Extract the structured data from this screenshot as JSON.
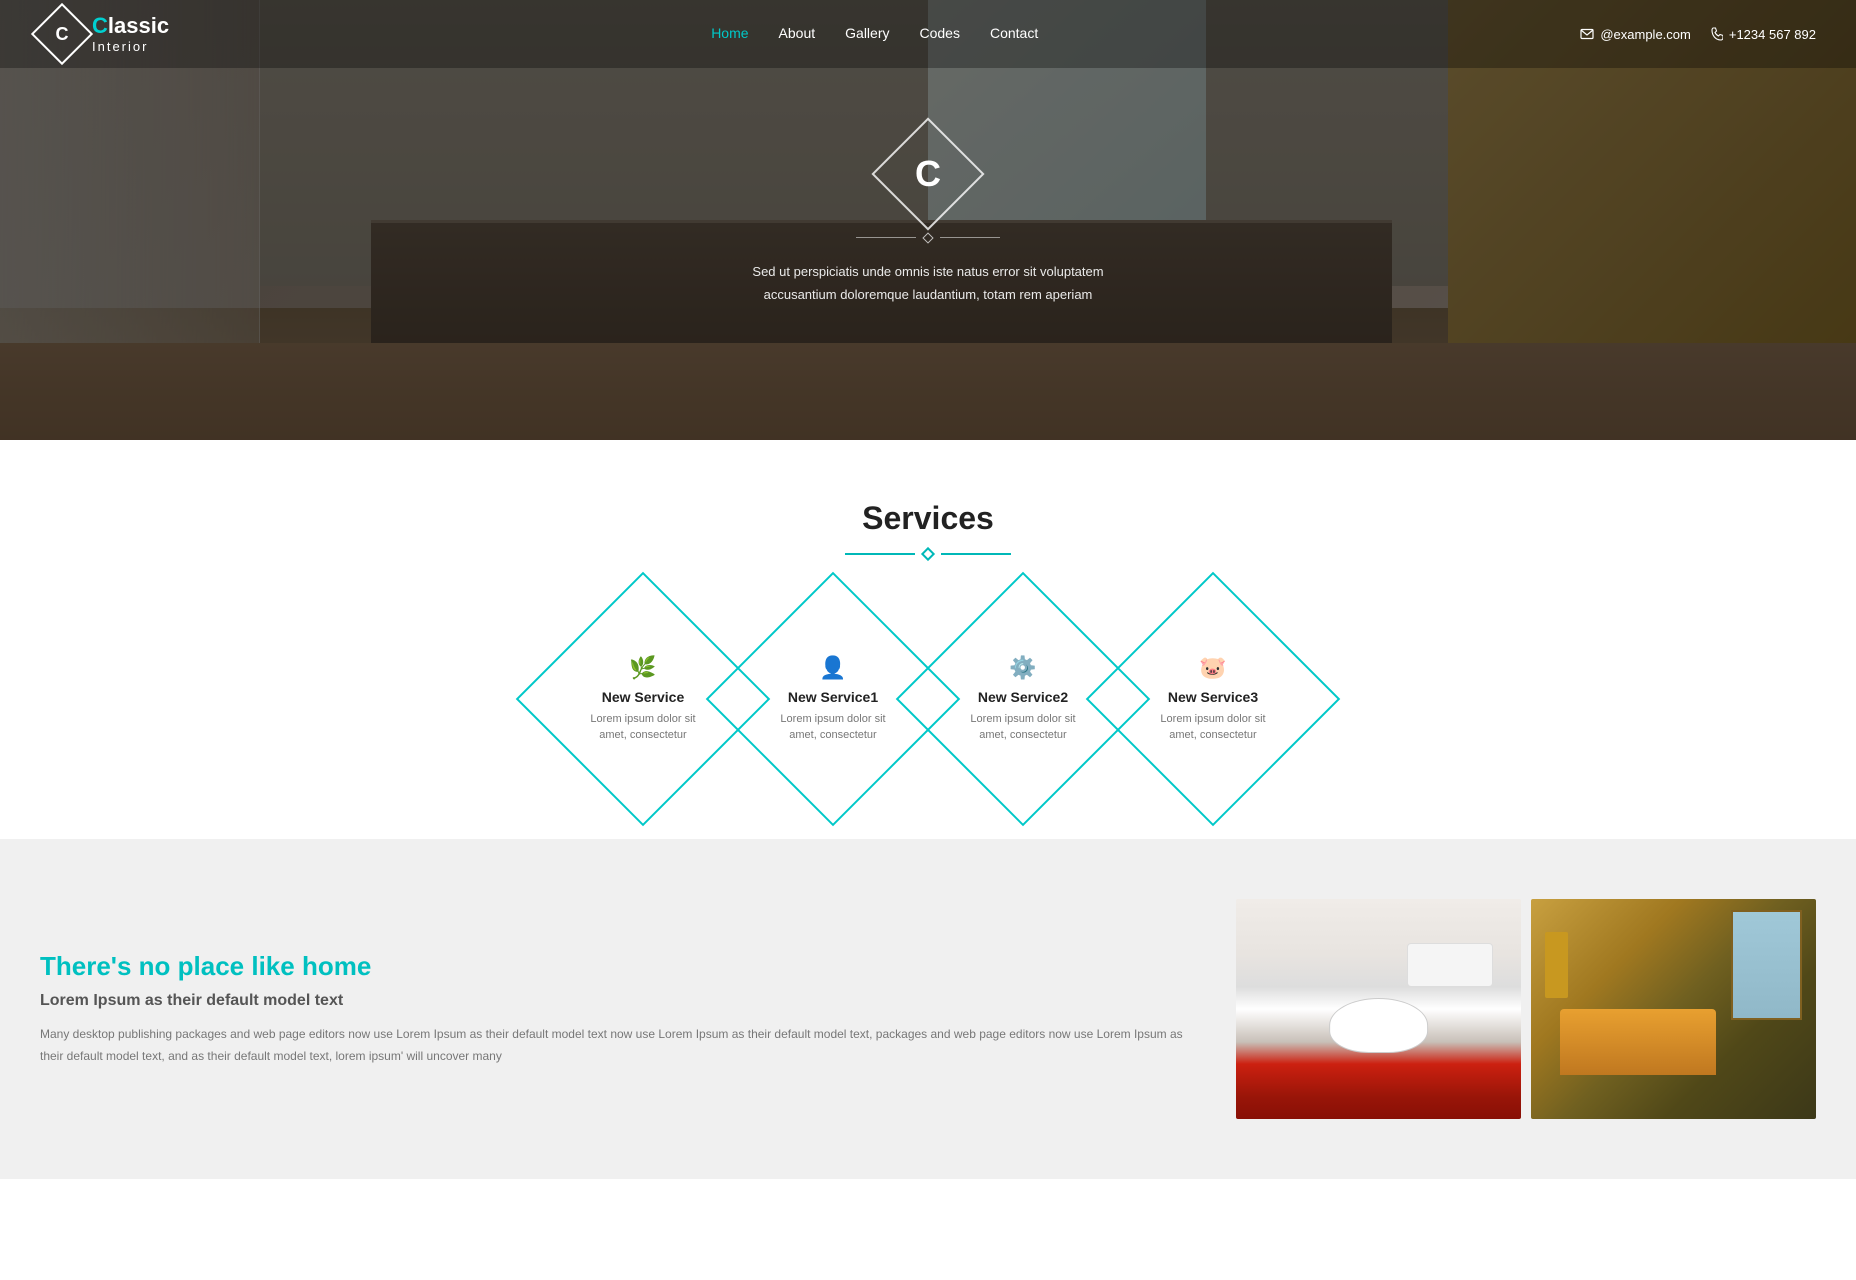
{
  "navbar": {
    "logo": {
      "letter": "C",
      "brand": "lassic",
      "sub": "Interior"
    },
    "nav_items": [
      {
        "label": "Home",
        "active": true
      },
      {
        "label": "About",
        "active": false
      },
      {
        "label": "Gallery",
        "active": false
      },
      {
        "label": "Codes",
        "active": false
      },
      {
        "label": "Contact",
        "active": false
      }
    ],
    "contact_email": "@example.com",
    "contact_phone": "+1234 567 892"
  },
  "hero": {
    "letter": "C",
    "tagline": "Sed ut perspiciatis unde omnis iste natus error sit voluptatem accusantium doloremque laudantium, totam rem aperiam"
  },
  "services": {
    "title": "Services",
    "items": [
      {
        "icon": "🌿",
        "name": "New Service",
        "desc": "Lorem ipsum dolor sit amet, consectetur"
      },
      {
        "icon": "👤",
        "name": "New Service1",
        "desc": "Lorem ipsum dolor sit amet, consectetur"
      },
      {
        "icon": "⚙️",
        "name": "New Service2",
        "desc": "Lorem ipsum dolor sit amet, consectetur"
      },
      {
        "icon": "🐷",
        "name": "New Service3",
        "desc": "Lorem ipsum dolor sit amet, consectetur"
      }
    ]
  },
  "about": {
    "heading": "There's no place like home",
    "subheading": "Lorem Ipsum as their default model text",
    "body": "Many desktop publishing packages and web page editors now use Lorem Ipsum as their default model text now use Lorem Ipsum as their default model text, packages and web page editors now use Lorem Ipsum as their default model text, and as their default model text, lorem ipsum' will uncover many"
  }
}
